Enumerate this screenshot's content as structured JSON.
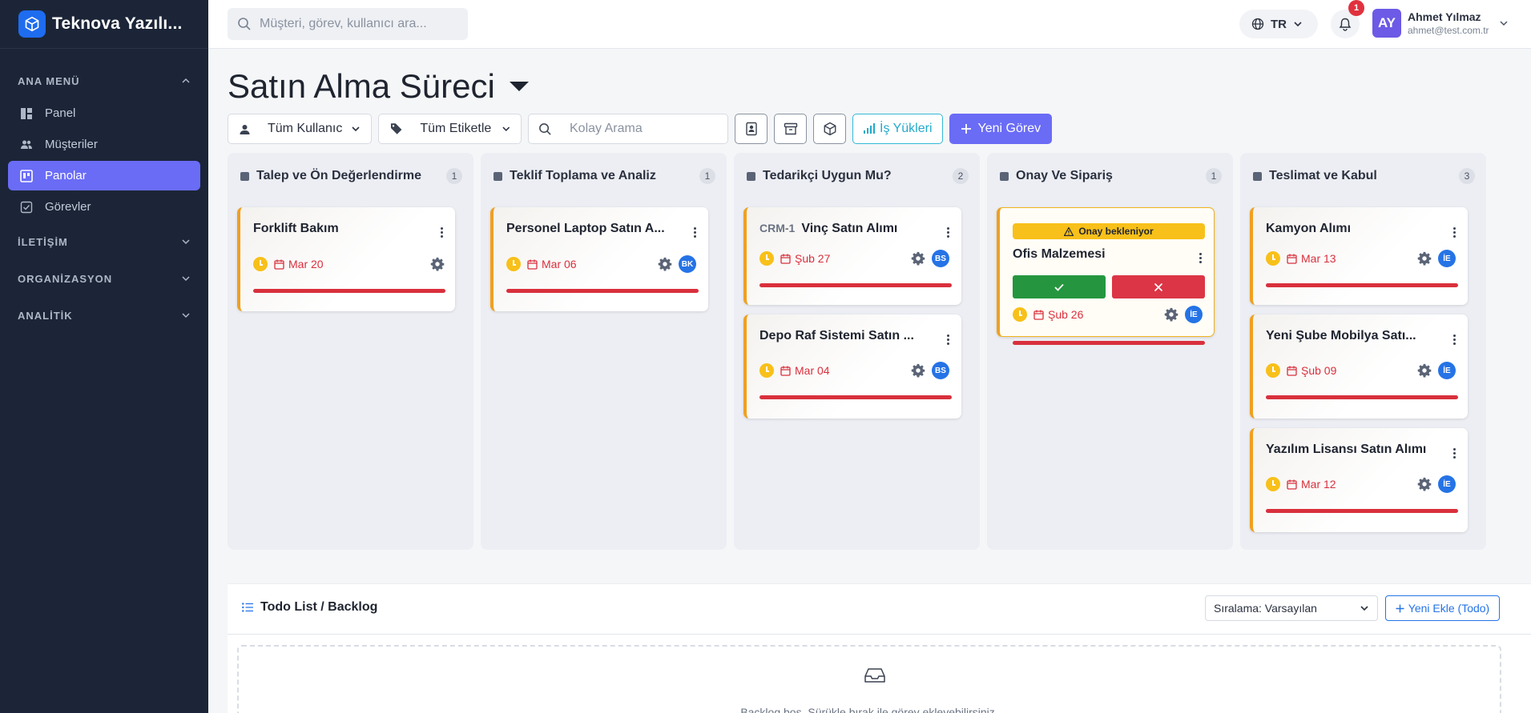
{
  "brand": {
    "name": "Teknova Yazılı..."
  },
  "sidebar": {
    "main_section": "ANA MENÜ",
    "items": [
      {
        "label": "Panel",
        "icon": "dashboard-icon"
      },
      {
        "label": "Müşteriler",
        "icon": "users-icon"
      },
      {
        "label": "Panolar",
        "icon": "board-icon",
        "active": true
      },
      {
        "label": "Görevler",
        "icon": "task-check-icon"
      }
    ],
    "groups": [
      {
        "label": "İLETİŞİM"
      },
      {
        "label": "ORGANİZASYON"
      },
      {
        "label": "ANALİTİK"
      }
    ]
  },
  "topbar": {
    "search_placeholder": "Müşteri, görev, kullanıcı ara...",
    "language": "TR",
    "notification_count": "1",
    "user": {
      "initials": "AY",
      "name": "Ahmet Yılmaz",
      "email": "ahmet@test.com.tr"
    }
  },
  "page": {
    "title": "Satın Alma Süreci"
  },
  "toolbar": {
    "user_filter": "Tüm Kullanıcı",
    "tag_filter": "Tüm Etiketle",
    "quick_search_placeholder": "Kolay Arama",
    "workload_label": "İş Yükleri",
    "new_task_label": "Yeni Görev"
  },
  "columns": [
    {
      "title": "Talep ve Ön Değerlendirme",
      "count": "1",
      "cards": [
        {
          "title": "Forklift Bakım",
          "due": "Mar 20"
        }
      ]
    },
    {
      "title": "Teklif Toplama ve Analiz",
      "count": "1",
      "cards": [
        {
          "title": "Personel Laptop Satın A...",
          "due": "Mar 06",
          "assignee": "BK"
        }
      ]
    },
    {
      "title": "Tedarikçi Uygun Mu?",
      "count": "2",
      "cards": [
        {
          "code": "CRM-1",
          "title": "Vinç Satın Alımı",
          "due": "Şub 27",
          "assignee": "BS"
        },
        {
          "title": "Depo Raf Sistemi Satın ...",
          "due": "Mar 04",
          "assignee": "BS"
        }
      ]
    },
    {
      "title": "Onay Ve Sipariş",
      "count": "1",
      "cards": [
        {
          "approval": "Onay bekleniyor",
          "title": "Ofis Malzemesi",
          "due": "Şub 26",
          "assignee": "İE"
        }
      ]
    },
    {
      "title": "Teslimat ve Kabul",
      "count": "3",
      "cards": [
        {
          "title": "Kamyon Alımı",
          "due": "Mar 13",
          "assignee": "İE"
        },
        {
          "title": "Yeni Şube Mobilya Satı...",
          "due": "Şub 09",
          "assignee": "İE"
        },
        {
          "title": "Yazılım Lisansı Satın Alımı",
          "due": "Mar 12",
          "assignee": "İE"
        }
      ]
    }
  ],
  "todo": {
    "title": "Todo List / Backlog",
    "sort_label": "Sıralama: Varsayılan",
    "add_label": "Yeni Ekle (Todo)",
    "empty_text": "Backlog boş. Sürükle bırak ile görev ekleyebilirsiniz."
  },
  "colors": {
    "sidebar_bg": "#1b2537",
    "accent": "#6a6cf6",
    "brand_blue": "#1e6cf0",
    "card_border": "#f0a020",
    "danger": "#d9303c",
    "success": "#25963f",
    "warning": "#f8c01a",
    "info": "#22aacb"
  }
}
